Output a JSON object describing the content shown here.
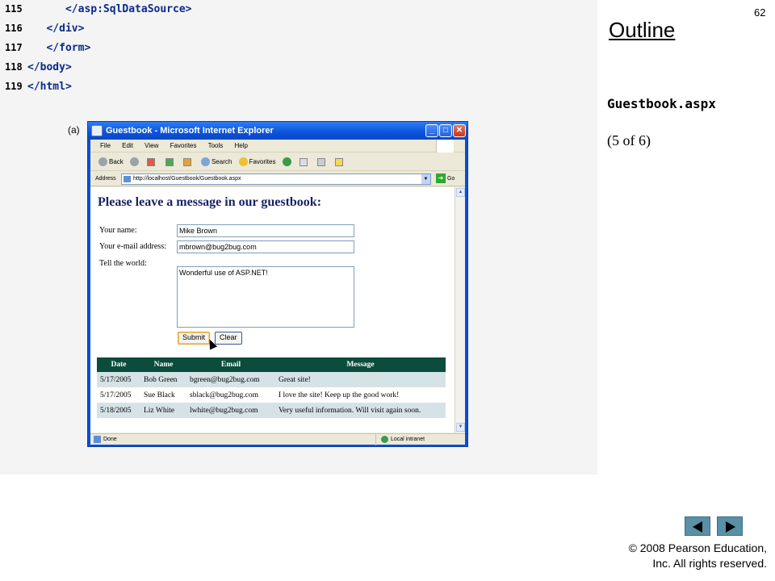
{
  "code": {
    "lines": [
      {
        "num": "115",
        "text": "      </asp:SqlDataSource>"
      },
      {
        "num": "116",
        "text": "   </div>"
      },
      {
        "num": "117",
        "text": "   </form>"
      },
      {
        "num": "118",
        "text": "</body>"
      },
      {
        "num": "119",
        "text": "</html>"
      }
    ]
  },
  "figure": {
    "label": "(a)"
  },
  "browser": {
    "title": "Guestbook - Microsoft Internet Explorer",
    "window_buttons": {
      "minimize": "_",
      "maximize": "□",
      "close": "✕"
    },
    "menu": [
      "File",
      "Edit",
      "View",
      "Favorites",
      "Tools",
      "Help"
    ],
    "toolbar": {
      "back": "Back",
      "search": "Search",
      "favorites": "Favorites"
    },
    "address_label": "Address",
    "address_url": "http://localhost/Guestbook/Guestbook.aspx",
    "go_label": "Go",
    "status": {
      "text": "Done",
      "zone": "Local intranet"
    }
  },
  "form": {
    "heading": "Please leave a message in our guestbook:",
    "name_label": "Your name:",
    "name_value": "Mike Brown",
    "email_label": "Your e-mail address:",
    "email_value": "mbrown@bug2bug.com",
    "message_label": "Tell the world:",
    "message_value": "Wonderful use of ASP.NET!",
    "submit_label": "Submit",
    "clear_label": "Clear"
  },
  "table": {
    "headers": [
      "Date",
      "Name",
      "Email",
      "Message"
    ],
    "rows": [
      [
        "5/17/2005",
        "Bob Green",
        "bgreen@bug2bug.com",
        "Great site!"
      ],
      [
        "5/17/2005",
        "Sue Black",
        "sblack@bug2bug.com",
        "I love the site! Keep up the good work!"
      ],
      [
        "5/18/2005",
        "Liz White",
        "lwhite@bug2bug.com",
        "Very useful information. Will visit again soon."
      ]
    ]
  },
  "slide": {
    "number": "62",
    "outline_title": "Outline",
    "file_name": "Guestbook.aspx",
    "page_of": "(5 of 6)",
    "copyright_line1": "© 2008 Pearson Education,",
    "copyright_line2": "Inc.  All rights reserved."
  },
  "colors": {
    "code_text": "#0a2a8a",
    "heading": "#1a2266",
    "table_header_bg": "#0b4c3c",
    "table_alt_row": "#d6e3e6",
    "nav_button": "#5a8fa8"
  }
}
